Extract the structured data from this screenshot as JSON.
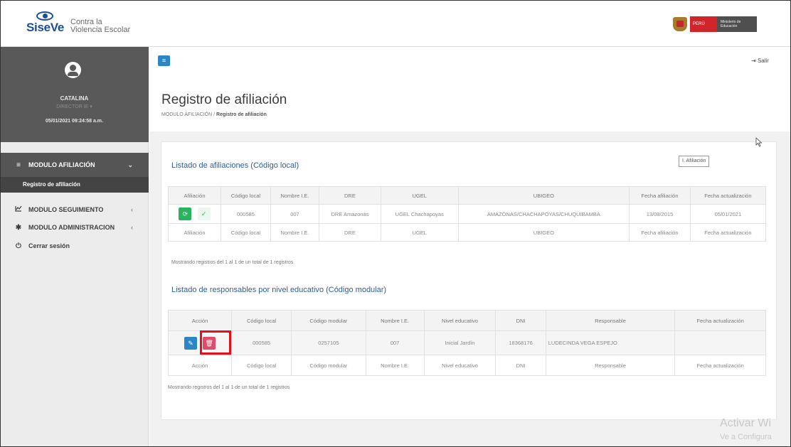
{
  "header": {
    "logo_word": "SiseVe",
    "logo_line1": "Contra la",
    "logo_line2": "Violencia Escolar",
    "gov_peru": "PERÚ",
    "gov_ministry": "Ministerio de Educación"
  },
  "sidebar": {
    "user_name": "CATALINA",
    "user_role": "DIRECTOR IE ▾",
    "user_datetime": "05/01/2021 09:24:58 a.m.",
    "items": [
      {
        "label": "MODULO AFILIACIÓN",
        "icon": "bars-icon",
        "chevron": "⌄"
      },
      {
        "label": "Registro de afiliación"
      },
      {
        "label": "MODULO SEGUIMIENTO",
        "icon": "chart-icon",
        "chevron": "‹"
      },
      {
        "label": "MODULO ADMINISTRACION",
        "icon": "gear-icon",
        "chevron": "‹"
      },
      {
        "label": "Cerrar sesión",
        "icon": "power-icon"
      }
    ]
  },
  "topnav": {
    "menu_toggle": "≡",
    "logout_label": "Salir"
  },
  "page": {
    "title": "Registro de afiliación",
    "breadcrumb_root": "MODULO AFILIACIÓN",
    "breadcrumb_sep": "/",
    "breadcrumb_current": "Registro de afiliación"
  },
  "afiliaciones": {
    "title": "Listado de afiliaciones (Código local)",
    "new_button": "I. Afiliación",
    "headers": [
      "Afiliación",
      "Código local",
      "Nombre I.E.",
      "DRE",
      "UGEL",
      "UBIGEO",
      "Fecha afiliación",
      "Fecha actualización"
    ],
    "row": [
      "000585",
      "007",
      "DRE Amazonas",
      "UGEL Chachapoyas",
      "AMAZONAS/CHACHAPOYAS/CHUQUIBAMBA",
      "13/08/2015",
      "05/01/2021"
    ],
    "footer": [
      "Afiliación",
      "Código local",
      "Nombre I.E.",
      "DRE",
      "UGEL",
      "UBIGEO",
      "Fecha afiliación",
      "Fecha actualización"
    ],
    "info": "Mostrando registros del 1 al 1 de un total de 1 registros"
  },
  "responsables": {
    "title": "Listado de responsables por nivel educativo (Código modular)",
    "headers": [
      "Acción",
      "Código local",
      "Código modular",
      "Nombre I.E.",
      "Nivel educativo",
      "DNI",
      "Responsable",
      "Fecha actualización"
    ],
    "row": [
      "000585",
      "0257105",
      "007",
      "Inicial  Jardín",
      "18368176",
      "LUDECINDA VEGA ESPEJO",
      ""
    ],
    "footer": [
      "Acción",
      "Código local",
      "Código modular",
      "Nombre I.E.",
      "Nivel educativo",
      "DNI",
      "Responsable",
      "Fecha actualización"
    ],
    "info": "Mostrando registros del 1 al 1 de un total de 1 registros"
  },
  "watermark": {
    "line1": "Activar Wi",
    "line2": "Ve a Configura"
  },
  "colors": {
    "primary": "#2b86c7",
    "success": "#27b45d",
    "danger": "#e04b6a",
    "sidebar_dark": "#595959",
    "highlight": "#e0101c"
  }
}
